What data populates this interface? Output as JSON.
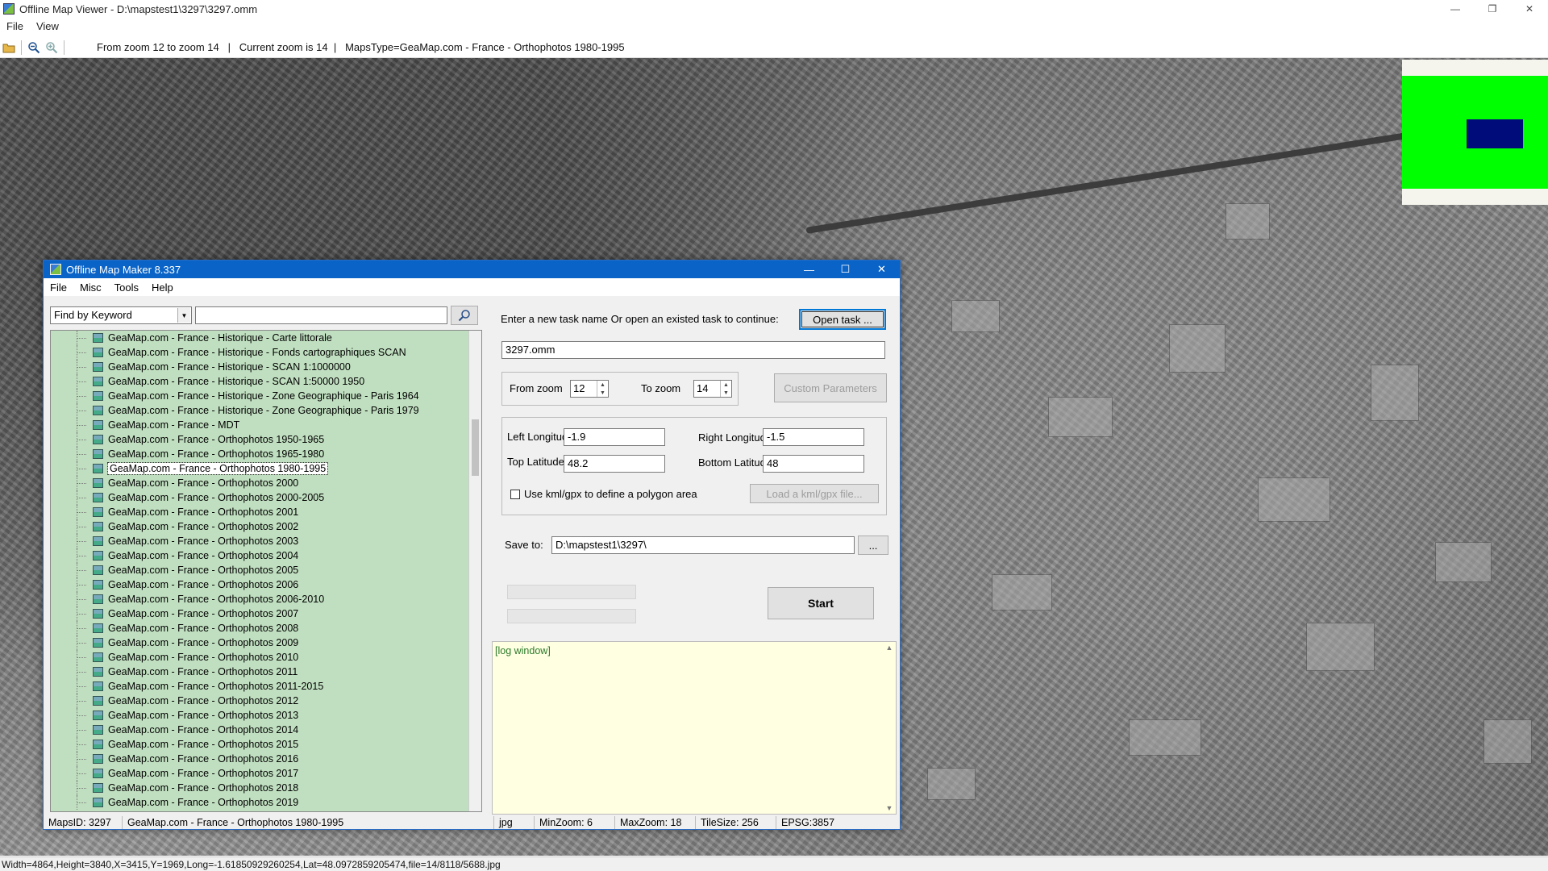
{
  "outer_window": {
    "title": "Offline Map Viewer - D:\\mapstest1\\3297\\3297.omm",
    "menu": [
      "File",
      "View"
    ],
    "toolbar_status": {
      "zoom_range": "From zoom 12 to zoom 14",
      "current_zoom": "Current zoom is 14",
      "maps_type": "MapsType=GeaMap.com - France - Orthophotos 1980-1995"
    },
    "status_bar": "Width=4864,Height=3840,X=3415,Y=1969,Long=-1.61850929260254,Lat=48.0972859205474,file=14/8118/5688.jpg"
  },
  "dialog": {
    "title": "Offline Map Maker 8.337",
    "menu": [
      "File",
      "Misc",
      "Tools",
      "Help"
    ],
    "search": {
      "mode": "Find by Keyword",
      "query": ""
    },
    "tree_items": [
      "GeaMap.com - France - Historique - Carte littorale",
      "GeaMap.com - France - Historique - Fonds cartographiques SCAN",
      "GeaMap.com - France - Historique - SCAN 1:1000000",
      "GeaMap.com - France - Historique - SCAN 1:50000 1950",
      "GeaMap.com - France - Historique - Zone Geographique - Paris 1964",
      "GeaMap.com - France - Historique - Zone Geographique - Paris 1979",
      "GeaMap.com - France - MDT",
      "GeaMap.com - France - Orthophotos 1950-1965",
      "GeaMap.com - France - Orthophotos 1965-1980",
      "GeaMap.com - France - Orthophotos 1980-1995",
      "GeaMap.com - France - Orthophotos 2000",
      "GeaMap.com - France - Orthophotos 2000-2005",
      "GeaMap.com - France - Orthophotos 2001",
      "GeaMap.com - France - Orthophotos 2002",
      "GeaMap.com - France - Orthophotos 2003",
      "GeaMap.com - France - Orthophotos 2004",
      "GeaMap.com - France - Orthophotos 2005",
      "GeaMap.com - France - Orthophotos 2006",
      "GeaMap.com - France - Orthophotos 2006-2010",
      "GeaMap.com - France - Orthophotos 2007",
      "GeaMap.com - France - Orthophotos 2008",
      "GeaMap.com - France - Orthophotos 2009",
      "GeaMap.com - France - Orthophotos 2010",
      "GeaMap.com - France - Orthophotos 2011",
      "GeaMap.com - France - Orthophotos 2011-2015",
      "GeaMap.com - France - Orthophotos 2012",
      "GeaMap.com - France - Orthophotos 2013",
      "GeaMap.com - France - Orthophotos 2014",
      "GeaMap.com - France - Orthophotos 2015",
      "GeaMap.com - France - Orthophotos 2016",
      "GeaMap.com - France - Orthophotos 2017",
      "GeaMap.com - France - Orthophotos 2018",
      "GeaMap.com - France - Orthophotos 2019"
    ],
    "selected_item": "GeaMap.com - France - Orthophotos 1980-1995",
    "task_prompt": "Enter a new task name Or open an existed task to continue:",
    "open_task_label": "Open task ...",
    "task_name": "3297.omm",
    "from_zoom_label": "From zoom",
    "from_zoom": "12",
    "to_zoom_label": "To zoom",
    "to_zoom": "14",
    "custom_params_label": "Custom Parameters",
    "left_lon_label": "Left Longitude",
    "left_lon": "-1.9",
    "right_lon_label": "Right Longitude",
    "right_lon": "-1.5",
    "top_lat_label": "Top Latitude",
    "top_lat": "48.2",
    "bottom_lat_label": "Bottom Latitude",
    "bottom_lat": "48",
    "kml_checkbox_label": "Use kml/gpx to define a polygon area",
    "kml_checked": false,
    "load_kml_label": "Load a kml/gpx file...",
    "save_to_label": "Save to:",
    "save_to_path": "D:\\mapstest1\\3297\\",
    "browse_label": "...",
    "start_label": "Start",
    "log_text": "[log window]",
    "status": {
      "maps_id": "MapsID: 3297",
      "map_name": "GeaMap.com - France - Orthophotos 1980-1995",
      "format": "jpg",
      "min_zoom": "MinZoom: 6",
      "max_zoom": "MaxZoom: 18",
      "tile_size": "TileSize: 256",
      "epsg": "EPSG:3857"
    }
  },
  "colors": {
    "dialog_title_bar": "#0a64c8",
    "tree_background": "#c0dfc0",
    "log_background": "#ffffe1",
    "minimap_green": "#00ff00",
    "minimap_viewport": "#000c7a"
  }
}
